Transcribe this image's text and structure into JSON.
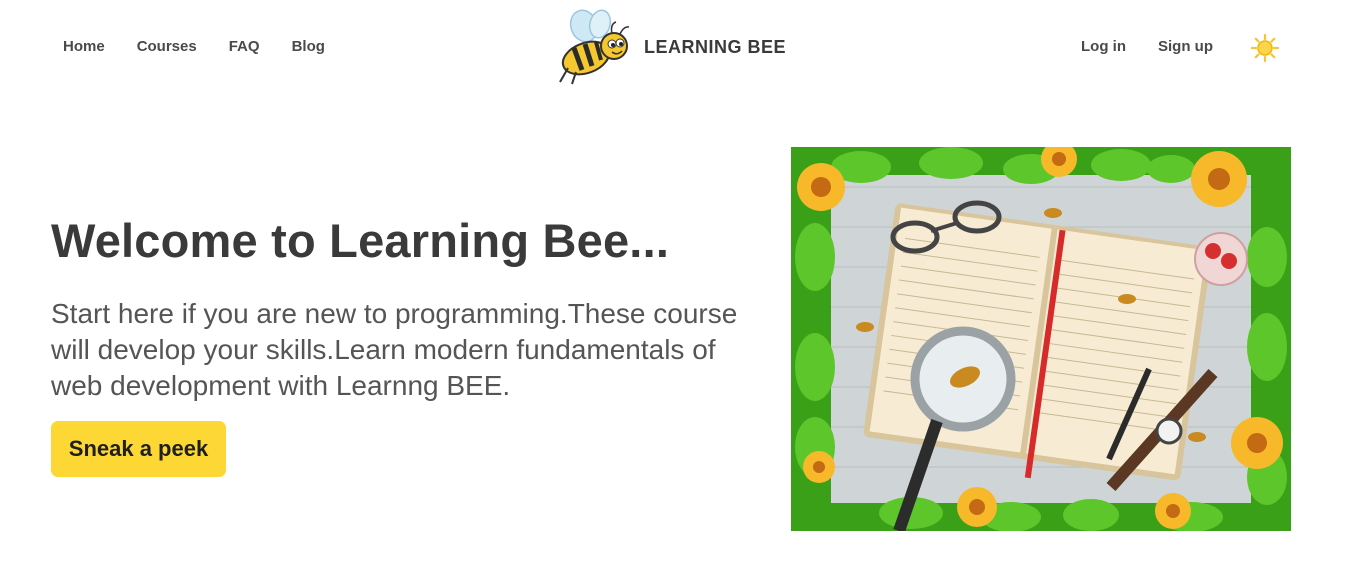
{
  "nav": {
    "links": [
      "Home",
      "Courses",
      "FAQ",
      "Blog"
    ],
    "brand": "LEARNING BEE",
    "login": "Log in",
    "signup": "Sign up",
    "theme_icon": "sun-icon"
  },
  "hero": {
    "title": "Welcome to Learning Bee...",
    "text": "Start here if you are new to programming.These course will develop your skills.Learn modern fundamentals of web development with Learnng BEE.",
    "cta": "Sneak a peek"
  },
  "colors": {
    "accent": "#fdd835",
    "text": "#3a3a3a",
    "sun": "#f7c531"
  },
  "image": {
    "subject": "notebook-desk-illustration"
  }
}
